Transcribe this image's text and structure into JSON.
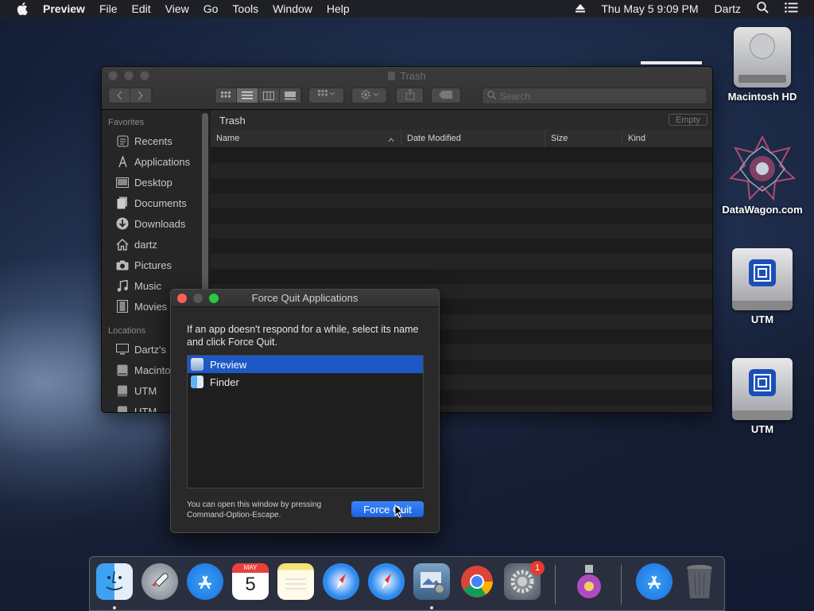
{
  "menubar": {
    "app_name": "Preview",
    "items": [
      "File",
      "Edit",
      "View",
      "Go",
      "Tools",
      "Window",
      "Help"
    ],
    "datetime": "Thu May 5  9:09 PM",
    "user": "Dartz"
  },
  "finder": {
    "title": "Trash",
    "search_placeholder": "Search",
    "path_label": "Trash",
    "empty_button": "Empty",
    "columns": [
      "Name",
      "Date Modified",
      "Size",
      "Kind"
    ],
    "sidebar": {
      "favorites_heading": "Favorites",
      "favorites": [
        {
          "label": "Recents",
          "icon": "clock-icon"
        },
        {
          "label": "Applications",
          "icon": "applications-icon"
        },
        {
          "label": "Desktop",
          "icon": "desktop-icon"
        },
        {
          "label": "Documents",
          "icon": "documents-icon"
        },
        {
          "label": "Downloads",
          "icon": "downloads-icon"
        },
        {
          "label": "dartz",
          "icon": "home-icon"
        },
        {
          "label": "Pictures",
          "icon": "camera-icon"
        },
        {
          "label": "Music",
          "icon": "music-icon"
        },
        {
          "label": "Movies",
          "icon": "film-icon"
        }
      ],
      "locations_heading": "Locations",
      "locations": [
        {
          "label": "Dartz's",
          "icon": "computer-icon"
        },
        {
          "label": "Macinto",
          "icon": "disk-icon"
        },
        {
          "label": "UTM",
          "icon": "drive-icon"
        },
        {
          "label": "UTM",
          "icon": "drive-icon"
        }
      ]
    }
  },
  "force_quit": {
    "title": "Force Quit Applications",
    "message": "If an app doesn't respond for a while, select its name and click Force Quit.",
    "apps": [
      {
        "name": "Preview",
        "selected": true,
        "icon": "preview-icon"
      },
      {
        "name": "Finder",
        "selected": false,
        "icon": "finder-icon"
      }
    ],
    "hint_line1": "You can open this window by pressing",
    "hint_line2": "Command-Option-Escape.",
    "button": "Force Quit"
  },
  "desktop_icons": [
    {
      "label": "Macintosh HD",
      "icon": "hard-drive-icon"
    },
    {
      "label": "DataWagon.com",
      "icon": "datawagon-logo-icon"
    },
    {
      "label": "UTM",
      "icon": "usb-drive-icon"
    },
    {
      "label": "UTM",
      "icon": "usb-drive-icon"
    }
  ],
  "dock": {
    "apps": [
      "Finder",
      "Launchpad",
      "App Store",
      "Calendar",
      "Notes",
      "Safari",
      "Safari",
      "Preview",
      "Chrome",
      "System Preferences",
      "Installer",
      "App Store",
      "Trash"
    ],
    "calendar_month": "MAY",
    "calendar_day": "5",
    "system_prefs_badge": "1"
  },
  "colors": {
    "accent": "#1d58c6",
    "close": "#fe5f57",
    "minimize": "#febc2e",
    "zoom": "#28c840"
  }
}
